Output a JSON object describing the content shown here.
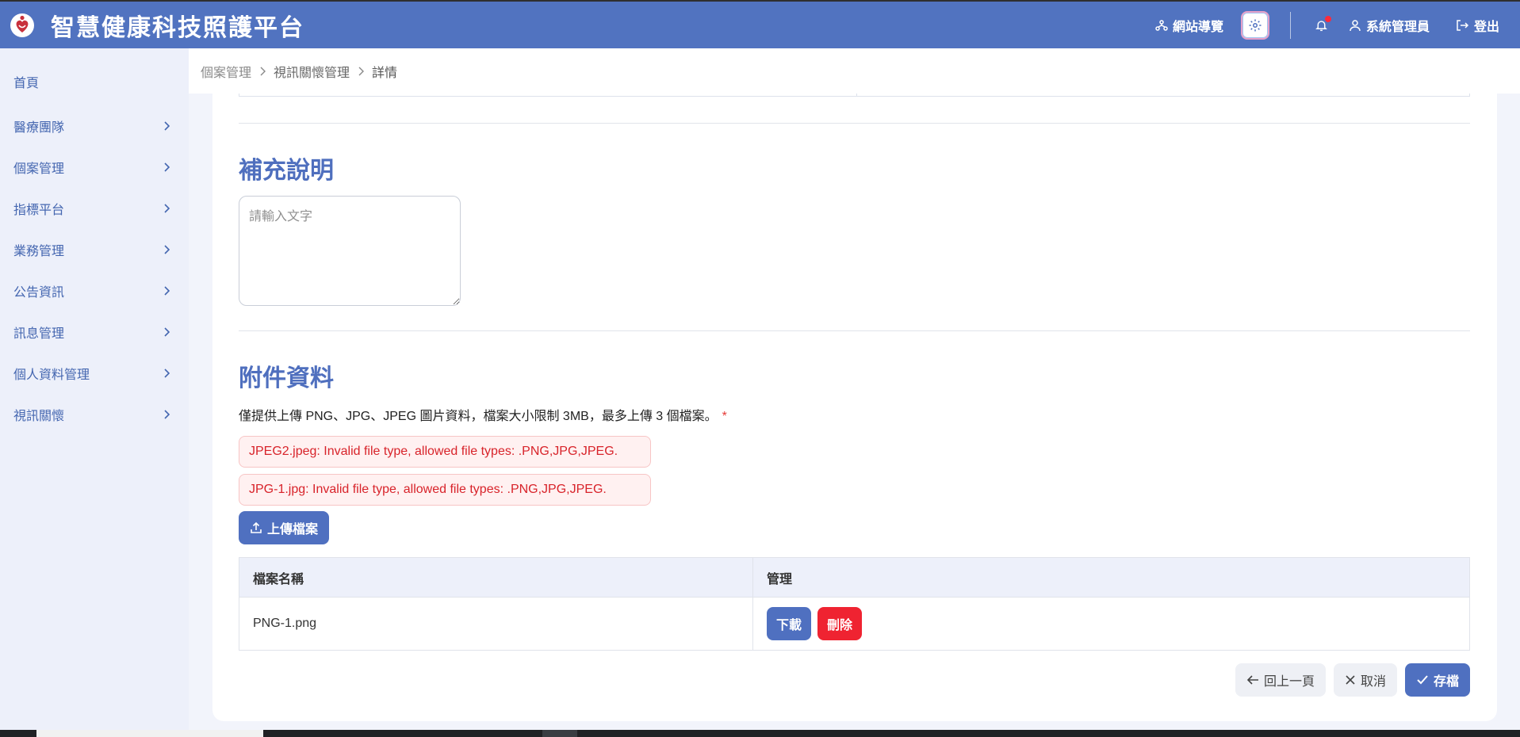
{
  "header": {
    "title": "智慧健康科技照護平台",
    "site_nav_label": "網站導覽",
    "user_label": "系統管理員",
    "logout_label": "登出"
  },
  "sidebar": {
    "items": [
      {
        "label": "首頁",
        "expandable": false
      },
      {
        "label": "醫療團隊",
        "expandable": true
      },
      {
        "label": "個案管理",
        "expandable": true
      },
      {
        "label": "指標平台",
        "expandable": true
      },
      {
        "label": "業務管理",
        "expandable": true
      },
      {
        "label": "公告資訊",
        "expandable": true
      },
      {
        "label": "訊息管理",
        "expandable": true
      },
      {
        "label": "個人資料管理",
        "expandable": true
      },
      {
        "label": "視訊關懷",
        "expandable": true
      }
    ]
  },
  "breadcrumb": [
    "個案管理",
    "視訊關懷管理",
    "詳情"
  ],
  "notes": {
    "title": "補充說明",
    "placeholder": "請輸入文字",
    "value": ""
  },
  "attachments": {
    "title": "附件資料",
    "hint": "僅提供上傳 PNG、JPG、JPEG 圖片資料，檔案大小限制 3MB，最多上傳 3 個檔案。",
    "required_mark": "*",
    "errors": [
      "JPEG2.jpeg: Invalid file type, allowed file types: .PNG,JPG,JPEG.",
      "JPG-1.jpg: Invalid file type, allowed file types: .PNG,JPG,JPEG."
    ],
    "upload_label": "上傳檔案",
    "table": {
      "headers": [
        "檔案名稱",
        "管理"
      ],
      "rows": [
        {
          "file_name": "PNG-1.png",
          "download_label": "下載",
          "delete_label": "刪除"
        }
      ]
    }
  },
  "footer_actions": {
    "back_label": "回上一頁",
    "cancel_label": "取消",
    "save_label": "存檔"
  },
  "colors": {
    "primary": "#4f70c0",
    "header_bg": "#5173c0",
    "danger": "#ef2331",
    "error_text": "#d8232a",
    "sidebar_bg": "#edf0fa"
  }
}
